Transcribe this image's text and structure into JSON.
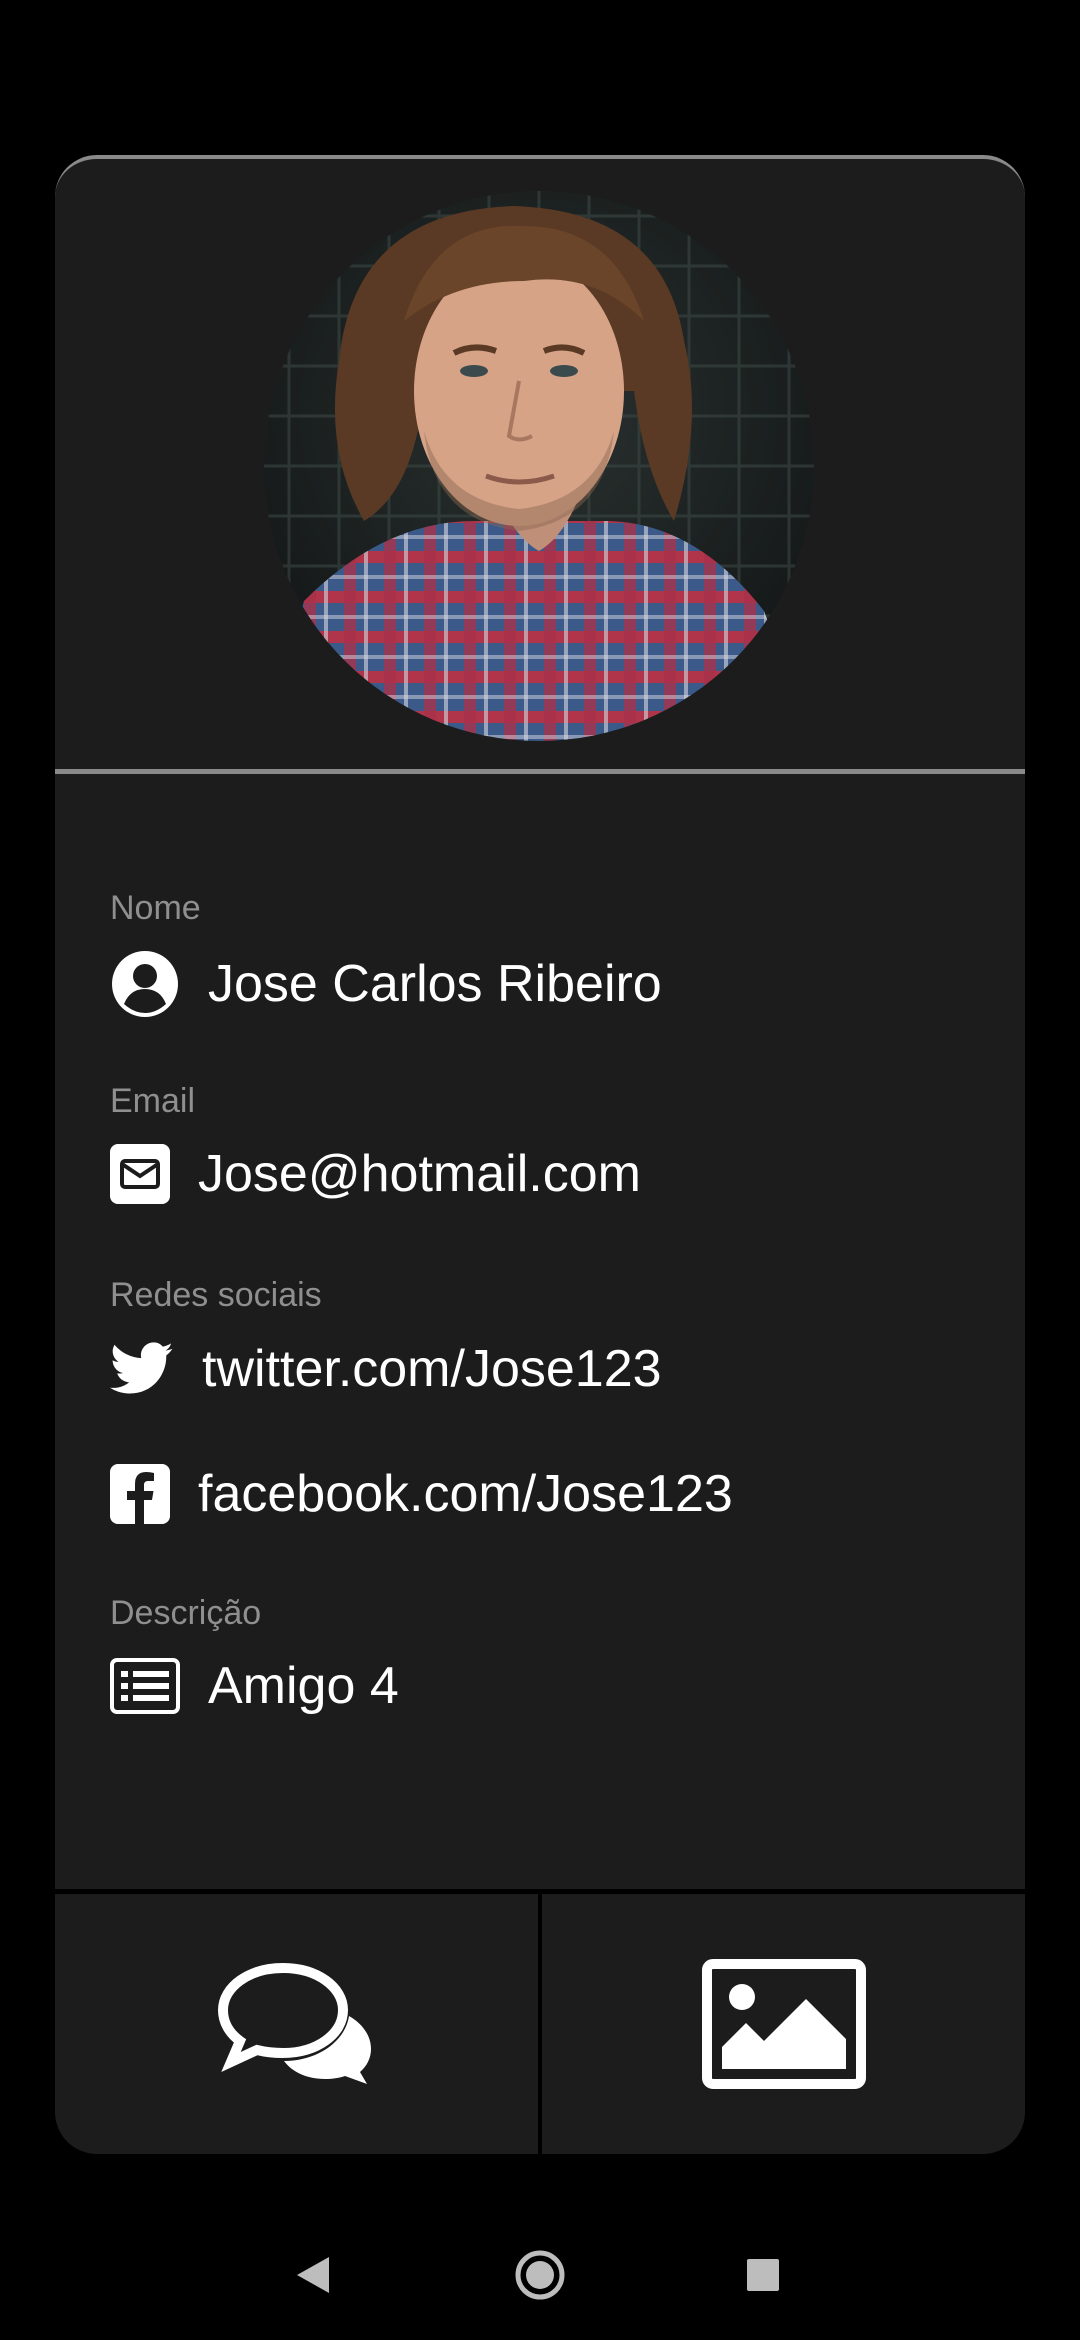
{
  "profile": {
    "avatar_alt": "Jose Carlos Ribeiro"
  },
  "fields": {
    "name_label": "Nome",
    "name_value": "Jose Carlos Ribeiro",
    "email_label": "Email",
    "email_value": "Jose@hotmail.com",
    "social_label": "Redes sociais",
    "twitter_value": "twitter.com/Jose123",
    "facebook_value": "facebook.com/Jose123",
    "description_label": "Descrição",
    "description_value": "Amigo 4"
  },
  "icons": {
    "name": "user-circle-icon",
    "email": "envelope-icon",
    "twitter": "twitter-icon",
    "facebook": "facebook-icon",
    "description": "list-icon",
    "chat": "chat-bubbles-icon",
    "gallery": "image-icon"
  },
  "colors": {
    "background": "#000000",
    "card": "#1c1c1c",
    "divider": "#8a8a8a",
    "label": "#8f8f8f",
    "text": "#ffffff"
  }
}
